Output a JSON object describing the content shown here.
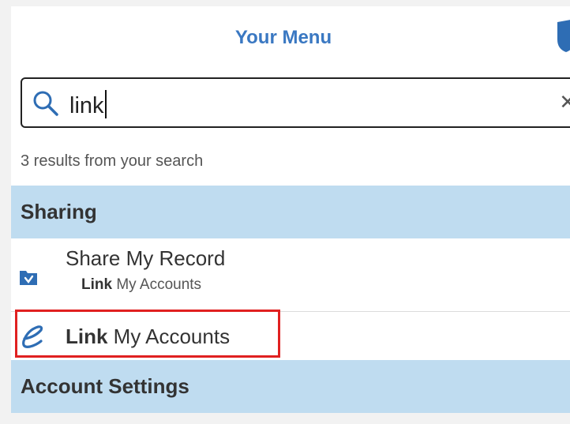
{
  "header": {
    "title": "Your Menu"
  },
  "search": {
    "value": "link"
  },
  "results_text": "3 results from your search",
  "sections": [
    {
      "name": "Sharing",
      "items": [
        {
          "title": "Share My Record",
          "match_bold": "Link",
          "match_rest": " My Accounts"
        },
        {
          "title_bold": "Link",
          "title_rest": " My Accounts"
        }
      ]
    },
    {
      "name": "Account Settings"
    }
  ],
  "colors": {
    "accent": "#3a78c2",
    "section_bg": "#bfdcf0",
    "highlight": "#e02020"
  },
  "icons": [
    "shield-icon",
    "search-icon",
    "folder-share-icon",
    "link-e-icon",
    "clear-icon"
  ]
}
